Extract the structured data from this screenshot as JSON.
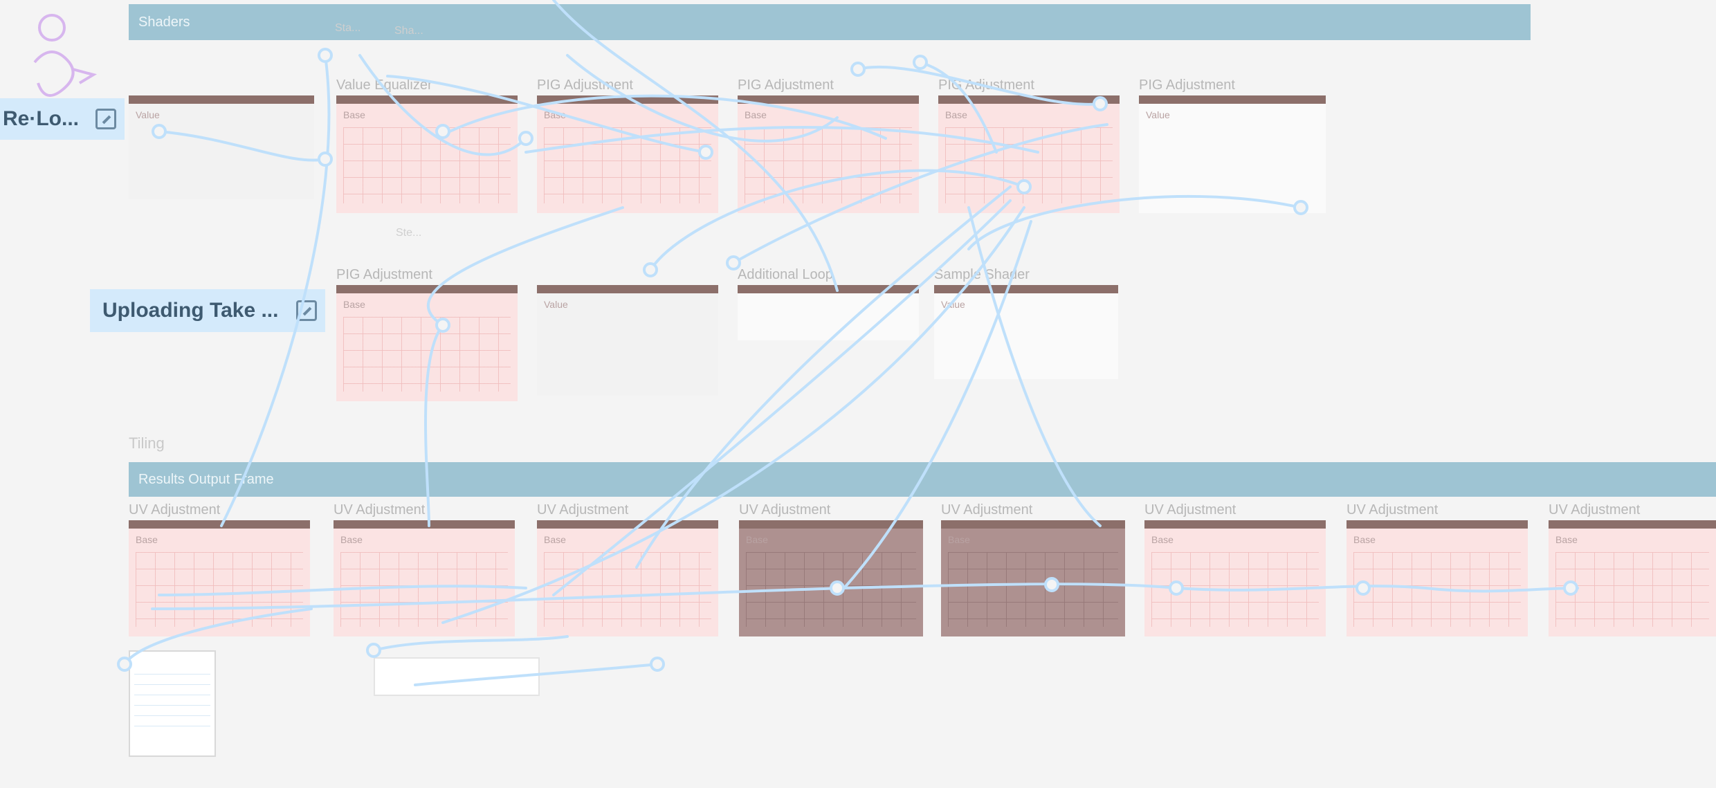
{
  "colors": {
    "group_header": "#9ec4d3",
    "node_bar": "#8c6f6a",
    "node_body": "#fbe3e3",
    "wire": "#bfe0fb",
    "pill": "#d4eafb"
  },
  "pills": [
    {
      "label": "Re·Lo...",
      "icon": "edit-icon"
    },
    {
      "label": "Uploading Take ...",
      "icon": "edit-icon"
    }
  ],
  "groups": [
    {
      "label": "Shaders",
      "caption": ""
    },
    {
      "label": "Results Output Frame",
      "caption": "Tiling"
    }
  ],
  "float_labels": [
    "Sta...",
    "Sha...",
    "Ste..."
  ],
  "rows": {
    "top": [
      {
        "title": "",
        "sub": "Value",
        "style": "grey"
      },
      {
        "title": "Value Equalizer",
        "sub": "Base",
        "style": "pink"
      },
      {
        "title": "PIG Adjustment",
        "sub": "Base",
        "style": "pink"
      },
      {
        "title": "PIG Adjustment",
        "sub": "Base",
        "style": "pink"
      },
      {
        "title": "PIG Adjustment",
        "sub": "Base",
        "style": "pink"
      },
      {
        "title": "PIG Adjustment",
        "sub": "Value",
        "style": "white"
      }
    ],
    "middle": [
      {
        "title": "PIG Adjustment",
        "sub": "Base",
        "style": "pink"
      },
      {
        "title": "",
        "sub": "Value",
        "style": "grey"
      },
      {
        "title": "Additional Loop",
        "sub": "",
        "style": "white"
      },
      {
        "title": "Sample Shader",
        "sub": "Value",
        "style": "white"
      }
    ],
    "bottom": [
      {
        "title": "UV Adjustment",
        "sub": "Base",
        "style": "pink"
      },
      {
        "title": "UV Adjustment",
        "sub": "Base",
        "style": "pink"
      },
      {
        "title": "UV Adjustment",
        "sub": "Base",
        "style": "pink"
      },
      {
        "title": "UV Adjustment",
        "sub": "Base",
        "style": "dark"
      },
      {
        "title": "UV Adjustment",
        "sub": "Base",
        "style": "dark"
      },
      {
        "title": "UV Adjustment",
        "sub": "Base",
        "style": "pink"
      },
      {
        "title": "UV Adjustment",
        "sub": "Base",
        "style": "pink"
      },
      {
        "title": "UV Adjustment",
        "sub": "Base",
        "style": "pink"
      }
    ]
  }
}
